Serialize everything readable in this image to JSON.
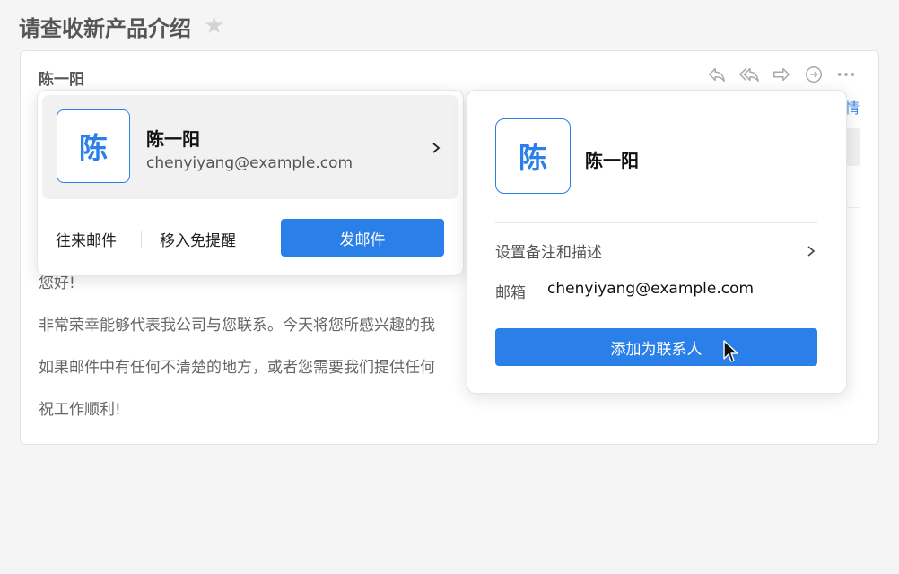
{
  "subject": {
    "title": "请查收新产品介绍",
    "star_icon": "star-icon"
  },
  "mail": {
    "sender": "陈一阳",
    "toolbar": [
      {
        "name": "reply-icon"
      },
      {
        "name": "reply-all-icon"
      },
      {
        "name": "forward-icon"
      },
      {
        "name": "comment-icon"
      },
      {
        "name": "more-icon"
      }
    ],
    "details_link": "情",
    "body": [
      "您好!",
      "非常荣幸能够代表我公司与您联系。今天将您所感兴趣的我",
      "如果邮件中有任何不清楚的地方，或者您需要我们提供任何",
      "祝工作顺利!"
    ]
  },
  "contact_card": {
    "avatar_char": "陈",
    "name": "陈一阳",
    "email": "chenyiyang@example.com",
    "actions": {
      "history": "往来邮件",
      "block": "移入免提醒",
      "send": "发邮件"
    }
  },
  "contact_detail": {
    "avatar_char": "陈",
    "name": "陈一阳",
    "remark_label": "设置备注和描述",
    "email_label": "邮箱",
    "email_value": "chenyiyang@example.com",
    "add_button": "添加为联系人"
  },
  "colors": {
    "accent": "#2b7fe8",
    "link": "#3a86e8"
  }
}
